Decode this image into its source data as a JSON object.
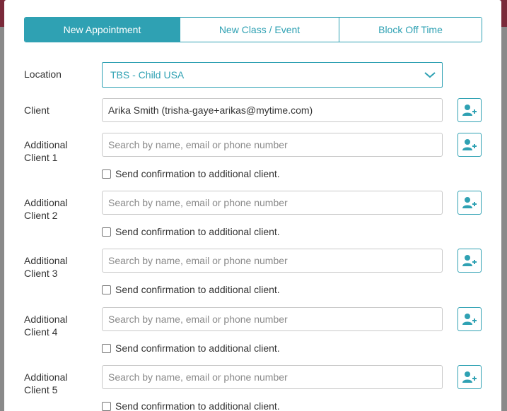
{
  "tabs": [
    {
      "label": "New Appointment",
      "active": true
    },
    {
      "label": "New Class / Event",
      "active": false
    },
    {
      "label": "Block Off Time",
      "active": false
    }
  ],
  "location": {
    "label": "Location",
    "value": "TBS - Child USA"
  },
  "client": {
    "label": "Client",
    "value": "Arika Smith (trisha-gaye+arikas@mytime.com)"
  },
  "additional_clients": [
    {
      "label_line1": "Additional",
      "label_line2": "Client 1",
      "placeholder": "Search by name, email or phone number",
      "checkbox_label": "Send confirmation to additional client."
    },
    {
      "label_line1": "Additional",
      "label_line2": "Client 2",
      "placeholder": "Search by name, email or phone number",
      "checkbox_label": "Send confirmation to additional client."
    },
    {
      "label_line1": "Additional",
      "label_line2": "Client 3",
      "placeholder": "Search by name, email or phone number",
      "checkbox_label": "Send confirmation to additional client."
    },
    {
      "label_line1": "Additional",
      "label_line2": "Client 4",
      "placeholder": "Search by name, email or phone number",
      "checkbox_label": "Send confirmation to additional client."
    },
    {
      "label_line1": "Additional",
      "label_line2": "Client 5",
      "placeholder": "Search by name, email or phone number",
      "checkbox_label": "Send confirmation to additional client."
    }
  ],
  "colors": {
    "accent": "#2fa1b3",
    "text": "#333333",
    "placeholder": "#8a8a8a",
    "border": "#c8c8c8"
  },
  "icons": {
    "add_client": "add-user-icon",
    "dropdown": "chevron-down-icon"
  }
}
